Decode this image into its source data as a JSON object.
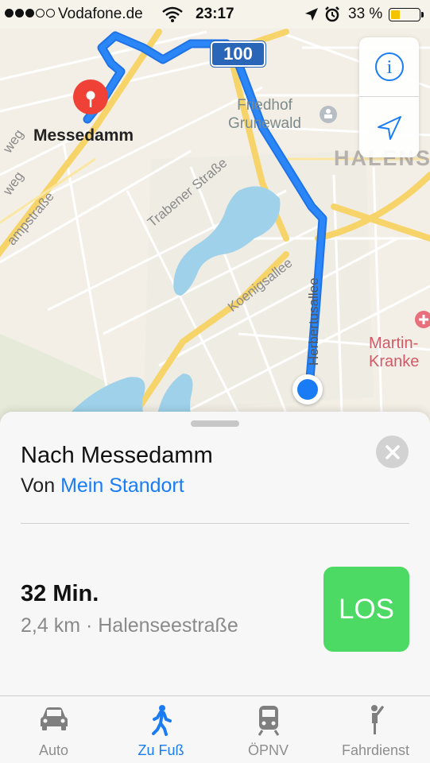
{
  "status_bar": {
    "carrier": "Vodafone.de",
    "time": "23:17",
    "battery_percent": "33 %",
    "battery_level": 0.33,
    "signal_bars_filled": 3,
    "signal_bars_total": 5
  },
  "map": {
    "destination_label": "Messedamm",
    "highway_number": "100",
    "poi_friedhof": "Friedhof\nGrunewald",
    "district": "HALENSE",
    "poi_hospital": "Martin-\nKranke",
    "streets": {
      "trabener": "Trabener Straße",
      "koenigsallee": "Koenigsallee",
      "herbert": "Herbertusallee",
      "kampf": "ampstraße",
      "weg1": "weg",
      "weg2": "weg"
    },
    "icons": {
      "info": "info-icon",
      "locate": "location-arrow-icon",
      "pin": "destination-pin-icon",
      "user": "current-location-icon"
    },
    "route_color": "#2b86f7",
    "pin_color": "#ef4136"
  },
  "card": {
    "title": "Nach Messedamm",
    "from_prefix": "Von ",
    "from_link": "Mein Standort",
    "duration": "32 Min.",
    "details": "2,4 km · Halenseestraße",
    "go_label": "LOS",
    "accent": "#1a7cf5",
    "go_color": "#4cd964"
  },
  "tabs": [
    {
      "label": "Auto",
      "icon": "car-icon",
      "active": false
    },
    {
      "label": "Zu Fuß",
      "icon": "walking-icon",
      "active": true
    },
    {
      "label": "ÖPNV",
      "icon": "train-icon",
      "active": false
    },
    {
      "label": "Fahrdienst",
      "icon": "ride-hail-icon",
      "active": false
    }
  ]
}
